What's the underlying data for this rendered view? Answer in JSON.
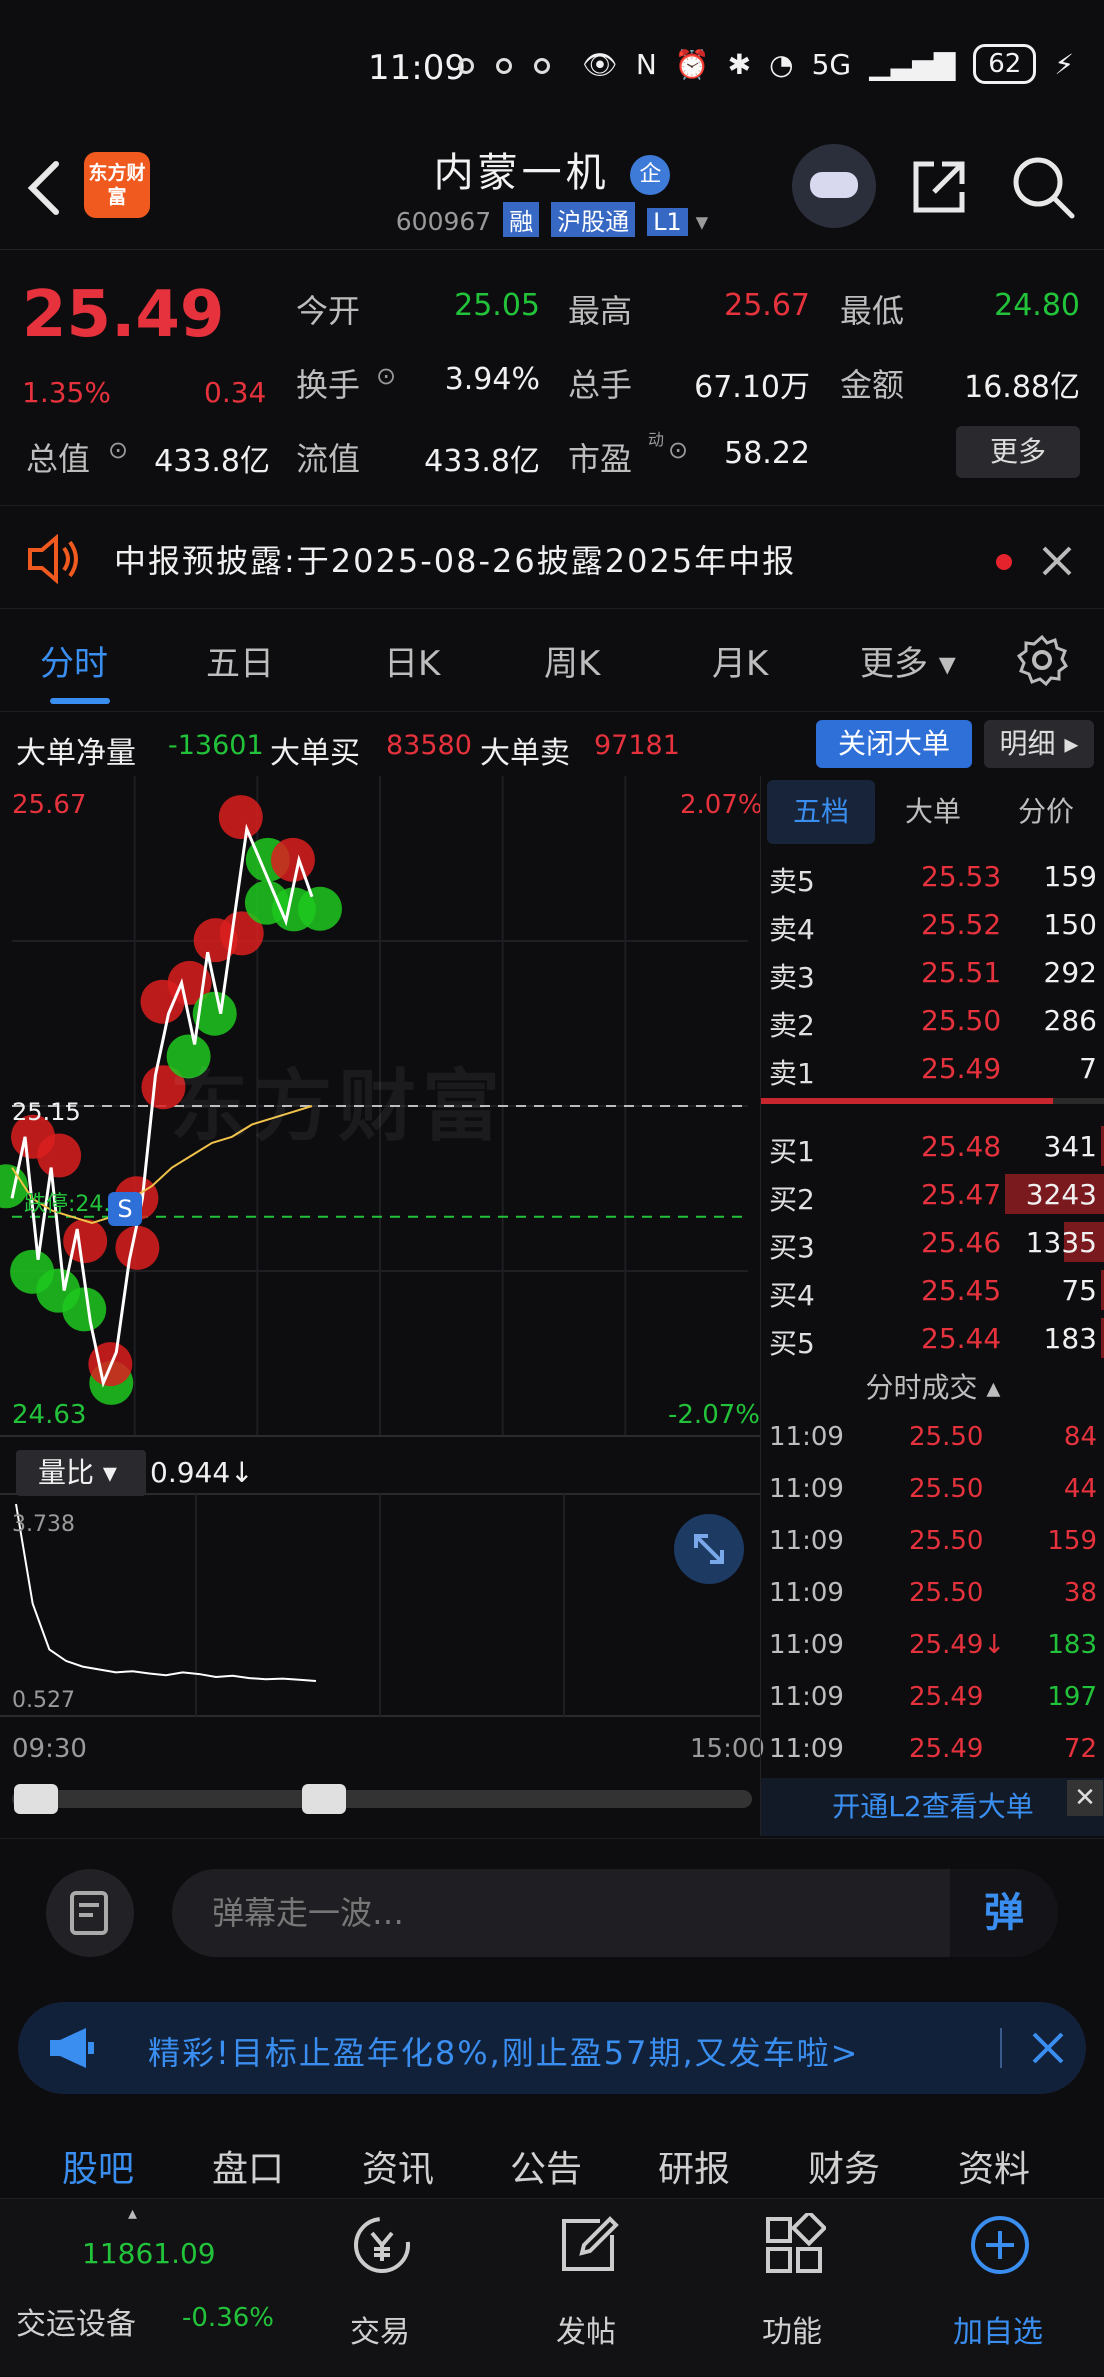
{
  "status_bar": {
    "time": "11:09",
    "network": "5G",
    "battery": "62"
  },
  "header": {
    "brand_logo": "东方财富",
    "stock_name": "内蒙一机",
    "qi_badge": "企",
    "code": "600967",
    "tags": [
      "融",
      "沪股通",
      "L1"
    ]
  },
  "quote": {
    "price": "25.49",
    "change_pct": "1.35%",
    "change_amt": "0.34",
    "open_label": "今开",
    "open_val": "25.05",
    "high_label": "最高",
    "high_val": "25.67",
    "low_label": "最低",
    "low_val": "24.80",
    "turnover_label": "换手",
    "turnover_val": "3.94%",
    "volume_label": "总手",
    "volume_val": "67.10万",
    "amount_label": "金额",
    "amount_val": "16.88亿",
    "mktcap_label": "总值",
    "mktcap_val": "433.8亿",
    "float_label": "流值",
    "float_val": "433.8亿",
    "pe_label": "市盈",
    "pe_sup": "动",
    "pe_val": "58.22",
    "more_button": "更多"
  },
  "notice": {
    "text": "中报预披露:于2025-08-26披露2025年中报"
  },
  "tabs": [
    "分时",
    "五日",
    "日K",
    "周K",
    "月K",
    "更多"
  ],
  "big_order": {
    "net_label": "大单净量",
    "net_val": "-13601",
    "buy_label": "大单买",
    "buy_val": "83580",
    "sell_label": "大单卖",
    "sell_val": "97181",
    "close_button": "关闭大单",
    "detail_button": "明细"
  },
  "chart": {
    "top_price": "25.67",
    "bottom_price": "24.63",
    "top_pct": "2.07%",
    "bottom_pct": "-2.07%",
    "mid_price": "25.15",
    "limit_text": "跌停:24.97",
    "watermark": "东方财富",
    "vol_select": "量比",
    "vol_val": "0.944↓",
    "vol_top": "3.738",
    "vol_bottom": "0.527",
    "time_start": "09:30",
    "time_end": "15:00"
  },
  "chart_data": {
    "type": "line",
    "title": "",
    "ylim": [
      24.63,
      25.67
    ],
    "prev_close": 25.15,
    "x": [
      "09:30",
      "11:09"
    ],
    "series": [
      {
        "values": [
          25.0,
          25.1,
          24.9,
          25.05,
          24.85,
          24.95,
          24.8,
          24.7,
          24.75,
          24.9,
          25.0,
          25.2,
          25.3,
          25.35,
          25.25,
          25.4,
          25.3,
          25.45,
          25.6,
          25.55,
          25.5,
          25.45,
          25.55,
          25.49
        ]
      },
      {
        "values": [
          25.05,
          25.0,
          24.98,
          24.97,
          24.96,
          24.97,
          25.0,
          25.02,
          25.05,
          25.07,
          25.09,
          25.1,
          25.12,
          25.13,
          25.14,
          25.15
        ]
      }
    ],
    "volume_ratio": {
      "ylim": [
        0.527,
        3.738
      ],
      "values": [
        3.738,
        2.0,
        1.2,
        1.0,
        0.9,
        0.85,
        0.8,
        0.82,
        0.78,
        0.75,
        0.8,
        0.77,
        0.72,
        0.74,
        0.7,
        0.68,
        0.69,
        0.67,
        0.65
      ]
    }
  },
  "book": {
    "tabs": [
      "五档",
      "大单",
      "分价"
    ],
    "asks": [
      {
        "name": "卖5",
        "price": "25.53",
        "qty": "159"
      },
      {
        "name": "卖4",
        "price": "25.52",
        "qty": "150"
      },
      {
        "name": "卖3",
        "price": "25.51",
        "qty": "292"
      },
      {
        "name": "卖2",
        "price": "25.50",
        "qty": "286"
      },
      {
        "name": "卖1",
        "price": "25.49",
        "qty": "7"
      }
    ],
    "bids": [
      {
        "name": "买1",
        "price": "25.48",
        "qty": "341",
        "bar": 0.03
      },
      {
        "name": "买2",
        "price": "25.47",
        "qty": "3243",
        "bar": 1.0
      },
      {
        "name": "买3",
        "price": "25.46",
        "qty": "1335",
        "bar": 0.41
      },
      {
        "name": "买4",
        "price": "25.45",
        "qty": "75",
        "bar": 0.02
      },
      {
        "name": "买5",
        "price": "25.44",
        "qty": "183",
        "bar": 0.02
      }
    ],
    "trades_title": "分时成交",
    "trades": [
      {
        "time": "11:09",
        "price": "25.50",
        "qty": "84",
        "color": "#e5323c"
      },
      {
        "time": "11:09",
        "price": "25.50",
        "qty": "44",
        "color": "#e5323c"
      },
      {
        "time": "11:09",
        "price": "25.50",
        "qty": "159",
        "color": "#e5323c"
      },
      {
        "time": "11:09",
        "price": "25.50",
        "qty": "38",
        "color": "#e5323c"
      },
      {
        "time": "11:09",
        "price": "25.49↓",
        "qty": "183",
        "color": "#22c33a"
      },
      {
        "time": "11:09",
        "price": "25.49",
        "qty": "197",
        "color": "#22c33a"
      },
      {
        "time": "11:09",
        "price": "25.49",
        "qty": "72",
        "color": "#e5323c"
      }
    ],
    "l2_banner": "开通L2查看大单"
  },
  "comment": {
    "placeholder": "弹幕走一波…",
    "send": "弹"
  },
  "promo": {
    "text": "精彩!目标止盈年化8%,刚止盈57期,又发车啦>"
  },
  "sub_tabs": [
    "股吧",
    "盘口",
    "资讯",
    "公告",
    "研报",
    "财务",
    "资料"
  ],
  "bottom_nav": {
    "index_val": "11861.09",
    "index_name": "交运设备",
    "index_chg": "-0.36%",
    "items": [
      "交易",
      "发帖",
      "功能",
      "加自选"
    ]
  }
}
